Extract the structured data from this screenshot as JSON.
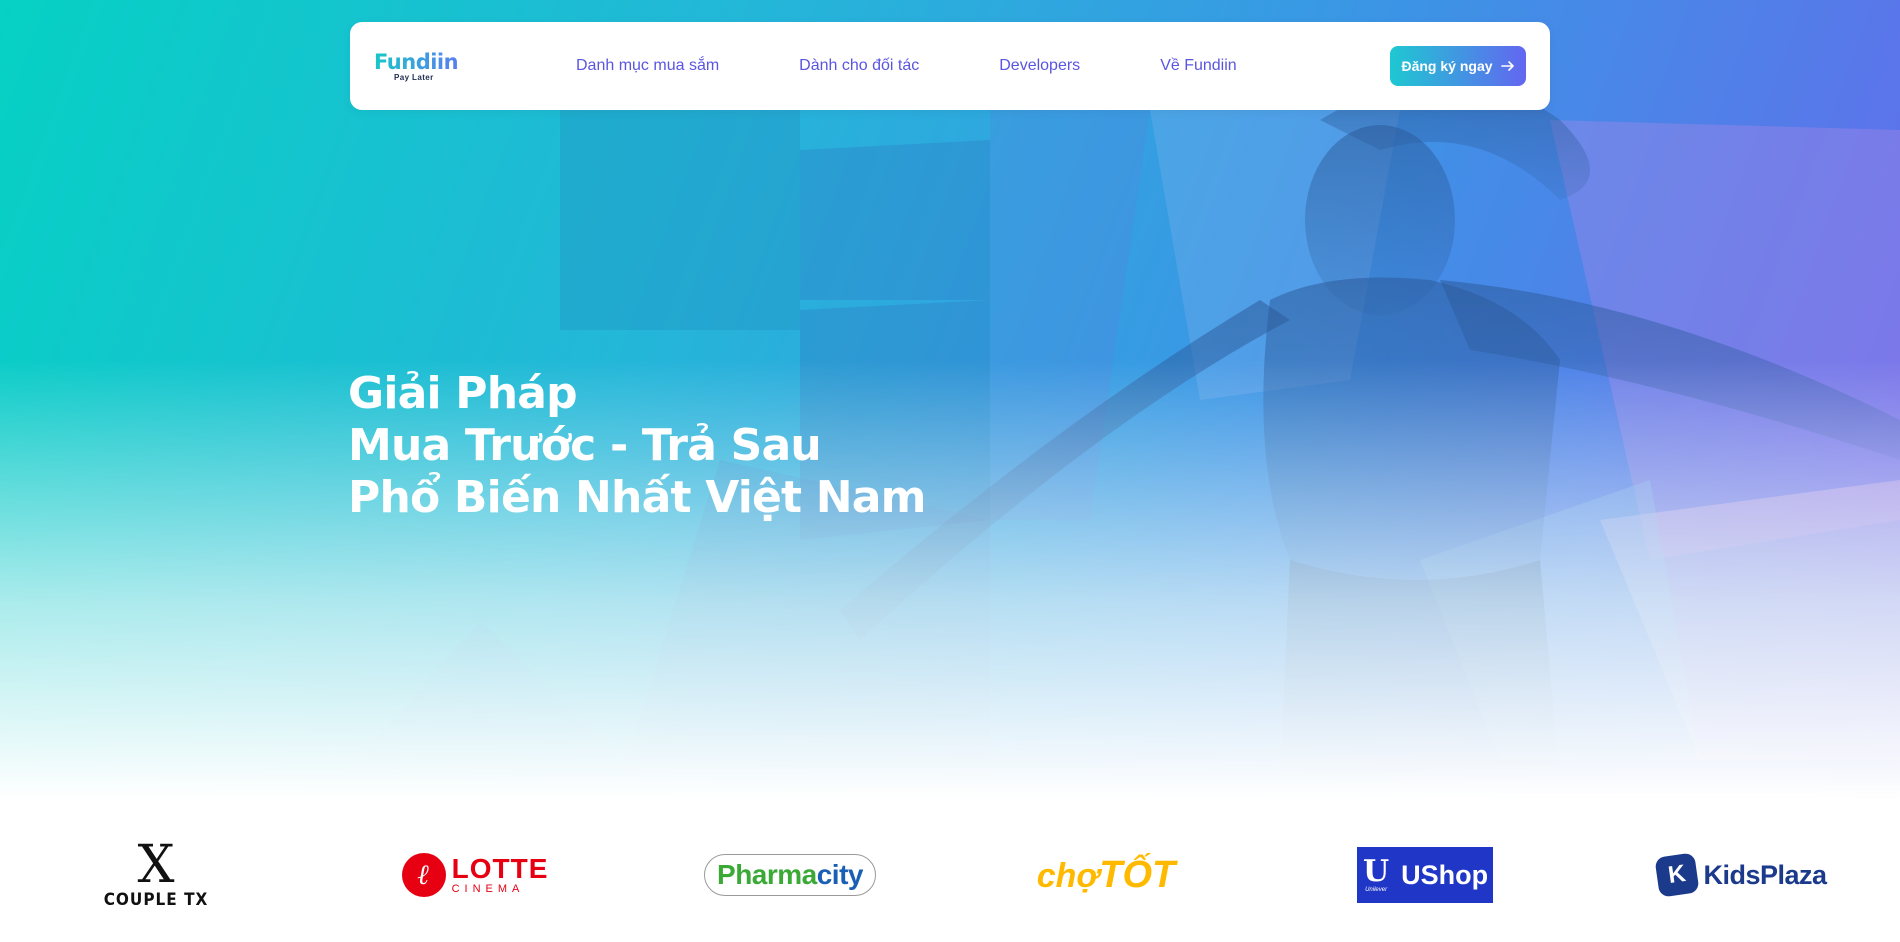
{
  "nav": {
    "logo_main": "Fundiin",
    "logo_sub": "Pay Later",
    "menu": [
      {
        "label": "Danh mục mua sắm"
      },
      {
        "label": "Dành cho đối tác"
      },
      {
        "label": "Developers"
      },
      {
        "label": "Về Fundiin"
      }
    ],
    "cta_label": "Đăng ký ngay",
    "cta_icon": "arrow-right-icon"
  },
  "hero": {
    "headline_lines": [
      "Giải Pháp",
      "Mua Trước - Trả Sau",
      "Phổ Biến Nhất Việt Nam"
    ]
  },
  "partners": [
    {
      "name": "COUPLE TX",
      "mark": "X"
    },
    {
      "name": "LOTTE",
      "sub": "CINEMA"
    },
    {
      "name": "Pharmacity",
      "part1": "Pharma",
      "part2": "city"
    },
    {
      "name": "chợTỐT",
      "part1": "chợ",
      "part2": "TỐT"
    },
    {
      "name": "UShop",
      "brand": "Unilever"
    },
    {
      "name": "KidsPlaza"
    }
  ],
  "colors": {
    "brand_gradient_start": "#1ec8d2",
    "brand_gradient_end": "#6366f1",
    "nav_link": "#5b55e0",
    "lotte_red": "#e60012",
    "pharmacity_green": "#3aa935",
    "pharmacity_blue": "#1a5fb4",
    "chotot_yellow": "#ffba00",
    "ushop_blue": "#1f36c7",
    "kidsplaza_navy": "#1b3a8c"
  }
}
